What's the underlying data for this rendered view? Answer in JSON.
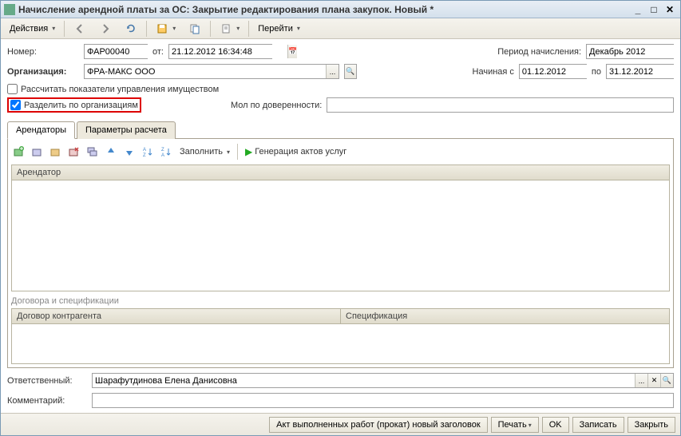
{
  "title": "Начисление арендной платы за ОС: Закрытие редактирования плана закупок. Новый *",
  "toolbar": {
    "actions": "Действия",
    "go": "Перейти"
  },
  "fields": {
    "number_label": "Номер:",
    "number_value": "ФАР00040",
    "from_label": "от:",
    "date_value": "21.12.2012 16:34:48",
    "period_label": "Период начисления:",
    "period_value": "Декабрь 2012",
    "org_label": "Организация:",
    "org_value": "ФРА-МАКС ООО",
    "starting_label": "Начиная с",
    "starting_value": "01.12.2012",
    "to_label": "по",
    "to_value": "31.12.2012",
    "calc_checkbox": "Рассчитать показатели управления имуществом",
    "split_checkbox": "Разделить по организациям",
    "mol_label": "Мол по доверенности:",
    "responsible_label": "Ответственный:",
    "responsible_value": "Шарафутдинова Елена Данисовна",
    "comment_label": "Комментарий:",
    "comment_value": ""
  },
  "tabs": {
    "t1": "Арендаторы",
    "t2": "Параметры расчета"
  },
  "subtoolbar": {
    "fill": "Заполнить",
    "generate": "Генерация актов услуг"
  },
  "grids": {
    "tenant_header": "Арендатор",
    "contracts_label": "Договора и спецификации",
    "contract_col": "Договор контрагента",
    "spec_col": "Спецификация"
  },
  "footer": {
    "act": "Акт выполненных работ (прокат) новый заголовок",
    "print": "Печать",
    "ok": "OK",
    "save": "Записать",
    "close": "Закрыть"
  }
}
